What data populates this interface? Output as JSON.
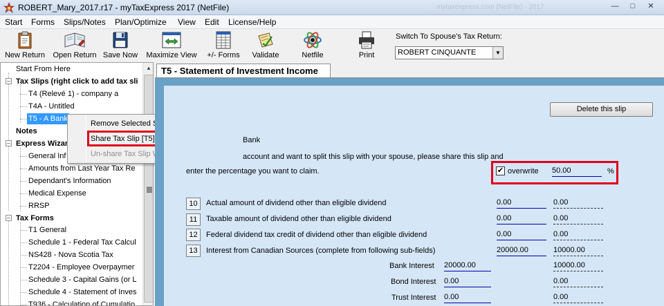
{
  "window": {
    "title": "ROBERT_Mary_2017.r17 - myTaxExpress 2017 (NetFile)",
    "faded_title": "· mytaxexpress.com (NetFile) · 2017"
  },
  "menu": [
    "Start",
    "Forms",
    "Slips/Notes",
    "Plan/Optimize",
    "View",
    "Edit",
    "License/Help"
  ],
  "toolbar": {
    "buttons": [
      "New Return",
      "Open Return",
      "Save Now",
      "Maximize View",
      "+/- Forms",
      "Validate",
      "Netfile",
      "Print"
    ],
    "spouse_label": "Switch To Spouse's Tax Return:",
    "spouse_value": "ROBERT CINQUANTE"
  },
  "tree": {
    "start": "Start From Here",
    "tax_slips": "Tax Slips (right click to add tax sli",
    "t4": "T4 (Relevé 1) - company a",
    "t4a": "T4A - Untitled",
    "t5": "T5 - A Bank",
    "notes": "Notes",
    "express": "Express Wizar",
    "general": "General Inf",
    "amounts": "Amounts from Last Year Tax Re",
    "dependant": "Dependant's Information",
    "medical": "Medical Expense",
    "rrsp": "RRSP",
    "tax_forms": "Tax Forms",
    "t1": "T1 General",
    "sch1": "Schedule 1 - Federal Tax Calcul",
    "ns428": "NS428 - Nova Scotia Tax",
    "t2204": "T2204 - Employee Overpaymer",
    "sch3": "Schedule 3 - Capital Gains (or L",
    "sch4": "Schedule 4 - Statement of Inves",
    "t936": "T936 - Calculation of Cumulatio"
  },
  "context_menu": {
    "remove": "Remove Selected Slip [T5]",
    "share": "Share Tax Slip [T5] With Spouse",
    "unshare": "Un-share Tax Slip With Spouse"
  },
  "tab": {
    "title": "T5 - Statement of Investment Income"
  },
  "form": {
    "delete_label": "Delete this slip",
    "bank_title": "Bank",
    "instruction1": "account and want to split this slip with your spouse, please share this slip and",
    "instruction2": "enter the percentage you want to claim.",
    "overwrite_label": "overwrite",
    "check_mark": "✔",
    "percent_value": "50.00",
    "percent_sign": "%",
    "rows": [
      {
        "box": "10",
        "label": "Actual amount of dividend other than eligible dividend",
        "v1": "0.00",
        "v2": "0.00"
      },
      {
        "box": "11",
        "label": "Taxable amount of dividend other than eligible dividend",
        "v1": "0.00",
        "v2": "0.00"
      },
      {
        "box": "12",
        "label": "Federal dividend tax credit of dividend other than eligible dividend",
        "v1": "0.00",
        "v2": "0.00"
      },
      {
        "box": "13",
        "label": "Interest from Canadian Sources (complete from following sub-fields)",
        "v1": "20000.00",
        "v2": "10000.00"
      }
    ],
    "sub": [
      {
        "label": "Bank Interest",
        "v1": "20000.00",
        "v2": "10000.00"
      },
      {
        "label": "Bond Interest",
        "v1": "0.00",
        "v2": "0.00"
      },
      {
        "label": "Trust Interest",
        "v1": "0.00",
        "v2": "0.00"
      }
    ]
  }
}
